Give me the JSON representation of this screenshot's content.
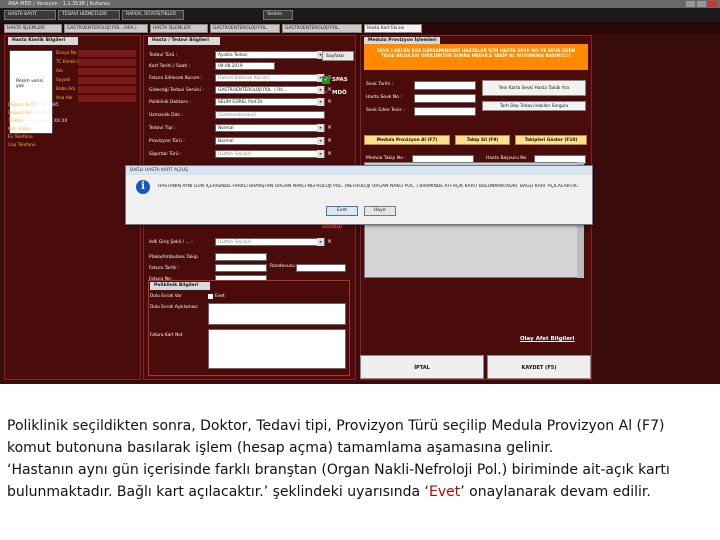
{
  "window": {
    "title": "ANA MED | Versiyon : 1.1.3538 | Kullanıcı"
  },
  "menubar": {
    "items": [
      "HASTA KAYIT",
      "TEDAVİ HİZMETLERİ",
      "RAPOR, İSTATİSTİKLER",
      "Yardım"
    ]
  },
  "tabs": [
    {
      "label": "HASTA İŞLEMLERİ"
    },
    {
      "label": "GASTROENTEROLOJİ POL. (ARA.)"
    },
    {
      "label": "HASTA İŞLEMLERİ"
    },
    {
      "label": "GASTROENTEROLOJİ POL."
    },
    {
      "label": "GASTROENTEROLOJİ POL."
    },
    {
      "label": "Hasta Kart Ekranı"
    }
  ],
  "left_panel": {
    "header": "Hasta Kimlik Bilgileri",
    "photo_text": "Resim verisi yok",
    "fields": [
      {
        "label": "Dosya No",
        "value": ""
      },
      {
        "label": "TC Kimlik No",
        "value": ""
      },
      {
        "label": "Adı",
        "value": ""
      },
      {
        "label": "Soyadı",
        "value": ""
      },
      {
        "label": "Baba Adı",
        "value": ""
      },
      {
        "label": "Ana Adı",
        "value": ""
      }
    ],
    "persons": [
      {
        "label": "Doğum Tarihi",
        "value": "27.05.1985"
      },
      {
        "label": "Doğum Yeri",
        "value": "MANİSA"
      },
      {
        "label": "Telefon",
        "value": "5XX XXX XX XX"
      },
      {
        "label": "Kan Grubu",
        "value": ""
      },
      {
        "label": "Ev Telefonu",
        "value": ""
      },
      {
        "label": "Cep Telefonu",
        "value": ""
      }
    ]
  },
  "mid_panel": {
    "header": "Hasta / Tedavi Bilgileri",
    "rows": [
      {
        "label": "Tedavi Türü :",
        "value": "Ayakta Tedavi",
        "placeholder": false
      },
      {
        "label": "Kart Tarihi / Saati :",
        "value": "09.08.2019",
        "placeholder": false
      },
      {
        "label": "Fatura Edilecek Kurum :",
        "value": "[Fatura Edilecek Kurum]",
        "placeholder": true
      },
      {
        "label": "Gideceği Tedavi Servisi :",
        "value": "GASTROENTEROLOJİ POL. ( RU...",
        "placeholder": false
      },
      {
        "label": "Poliklinik Doktoru :",
        "value": "SELİM GÜREL Prof.Dr.",
        "placeholder": false
      },
      {
        "label": "Uzmanlık Dalı :",
        "value": "[Gastroenteroloji]",
        "placeholder": true
      },
      {
        "label": "Tedavi Tipi :",
        "value": "Normal",
        "placeholder": false
      },
      {
        "label": "Provizyon Türü :",
        "value": "Normal",
        "placeholder": false
      },
      {
        "label": "Sigortalı Türü :",
        "value": "[Lütfen Seçiniz]",
        "placeholder": true
      }
    ],
    "side_button": "Sayfalar",
    "sps_label": "SPAS",
    "mdo_label": "MDÖ",
    "lower_rows": [
      {
        "label": "Adli Giriş Şekli / ... :",
        "value": "[Lütfen Seçiniz]",
        "placeholder": true
      },
      {
        "label": "Adli Giriş",
        "value": "",
        "placeholder": false
      },
      {
        "label": "Plaka/Ambulans Takip",
        "value": "",
        "placeholder": false
      },
      {
        "label": "Fatura Tarihi :",
        "value": "",
        "placeholder": false
      },
      {
        "label": "Fatura No :",
        "value": "",
        "placeholder": false
      }
    ],
    "randevu_label": "Randevusu",
    "dondur_label": "Döndür",
    "extra_panel": {
      "header": "Poliklinik Bilgileri",
      "rows": [
        {
          "label": "Dolu Evrak Var",
          "value": "Evet"
        },
        {
          "label": "Dolu Evrak Açıklaması",
          "value": ""
        },
        {
          "label": "Fatura Kart Not",
          "value": ""
        }
      ]
    }
  },
  "right_panel": {
    "header": "Medula Provizyon İşlemleri",
    "warning": "SEVK İ GELEN SGS KAPSAMINDAKİ HASTALAR İÇİN HASTA SEVK NO VE SEVK EDEN TESİS BİLGİLERİ GİRİLDİKTEN SONRA MEDULA TAKİP AL BUTONUNA BASINIZ!!!",
    "fields": [
      {
        "label": "Sevk Tarihi :"
      },
      {
        "label": "Hasta Sevk No :"
      },
      {
        "label": "Sevk Eden Tesis :"
      }
    ],
    "side_buttons": [
      "Yeni Karta Sevki Hasta Takibi Ara",
      "Tarh Dep Tedavi Hakları Sorgula"
    ],
    "main_buttons": [
      "Medula Provizyon Al (F7)",
      "Takip Sil (F9)",
      "Takipleri Göster (F10)"
    ],
    "takip_label": "Medula Takip No :",
    "basvuru_label": "Hasta Başvuru No",
    "afet": "Olay Afet Bilgileri",
    "iptal": "İPTAL",
    "kaydet": "KAYDET (F5)"
  },
  "dialog": {
    "title": "BAĞLI HASTA KART AÇILIŞ",
    "message": "HASTANIN AYNI GÜN İÇERİSİNDE FARKLI BRANŞTAN ORGAN NAKLİ-NEFROLOJİ POL. (NEFROLOJİ ORGAN NAKLİ POL. ) BİRİMİNDE AİT-AÇIK KARTI BULUNMAKTADIR. BAĞLI KART AÇILACAKTIR..",
    "yes": "Evet",
    "no": "Hayır"
  },
  "caption": {
    "line1": "Poliklinik seçildikten sonra, Doktor, Tedavi tipi, Provizyon Türü seçilip Medula Provizyon Al (F7)",
    "line2": "komut butonuna basılarak işlem (hesap açma) tamamlama aşamasına gelinir.",
    "line3": "‘Hastanın aynı gün içerisinde farklı branştan (Organ Nakli-Nefroloji Pol.) biriminde ait-açık kartı",
    "line4a": "bulunmaktadır. Bağlı kart açılacaktır.’ şeklindeki uyarısında ‘",
    "line4b": "Evet",
    "line4c": "’ onaylanarak devam edilir."
  }
}
